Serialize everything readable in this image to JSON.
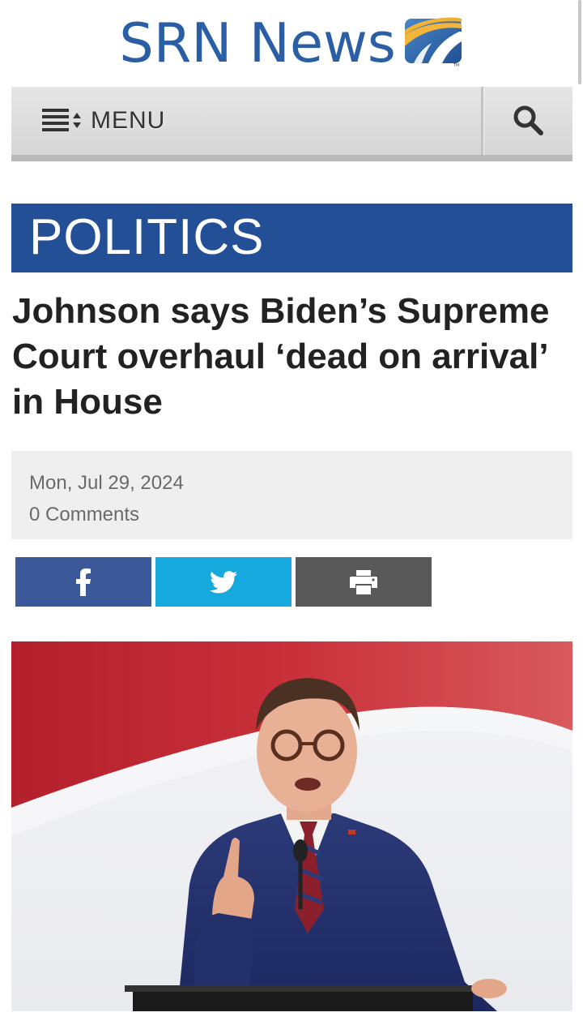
{
  "header": {
    "logo_text": "SRN News",
    "logo_trademark": "TM",
    "brand_color": "#2a5fa5"
  },
  "nav": {
    "menu_label": "MENU",
    "menu_icon": "menu-list-icon",
    "search_icon": "search-icon"
  },
  "section": {
    "title": "POLITICS",
    "color": "#234f96"
  },
  "article": {
    "headline": "Johnson says Biden’s Supreme Court overhaul ‘dead on arrival’ in House",
    "date": "Mon, Jul 29, 2024",
    "comments": "0 Comments"
  },
  "share": {
    "buttons": [
      {
        "name": "facebook",
        "icon": "facebook-icon",
        "color": "#3b5998"
      },
      {
        "name": "twitter",
        "icon": "twitter-icon",
        "color": "#15a9de"
      },
      {
        "name": "print",
        "icon": "print-icon",
        "color": "#595959"
      }
    ]
  }
}
